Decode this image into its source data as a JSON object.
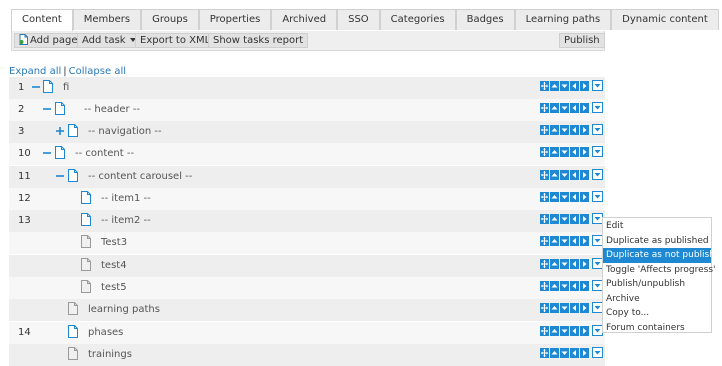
{
  "tabs": [
    {
      "label": "Content",
      "active": true
    },
    {
      "label": "Members"
    },
    {
      "label": "Groups"
    },
    {
      "label": "Properties"
    },
    {
      "label": "Archived"
    },
    {
      "label": "SSO"
    },
    {
      "label": "Categories"
    },
    {
      "label": "Badges"
    },
    {
      "label": "Learning paths"
    },
    {
      "label": "Dynamic content"
    }
  ],
  "toolbar": {
    "add_page": "Add page",
    "add_task": "Add task",
    "export_xml": "Export to XML",
    "show_tasks_report": "Show tasks report",
    "publish": "Publish"
  },
  "tree_controls": {
    "expand_all": "Expand all",
    "separator": "|",
    "collapse_all": "Collapse all"
  },
  "rows": [
    {
      "num": "1",
      "label": "fi",
      "toggle": "minus",
      "icon": "page-blue"
    },
    {
      "num": "2",
      "label": "-- header --",
      "toggle": "minus",
      "icon": "page-blue"
    },
    {
      "num": "3",
      "label": "-- navigation --",
      "toggle": "plus",
      "icon": "page-blue"
    },
    {
      "num": "10",
      "label": "-- content --",
      "toggle": "minus",
      "icon": "page-blue"
    },
    {
      "num": "11",
      "label": "-- content carousel --",
      "toggle": "minus",
      "icon": "page-blue"
    },
    {
      "num": "12",
      "label": "-- item1 --",
      "toggle": "",
      "icon": "page-blue"
    },
    {
      "num": "13",
      "label": "-- item2 --",
      "toggle": "",
      "icon": "page-blue"
    },
    {
      "num": "",
      "label": "Test3",
      "toggle": "",
      "icon": "page-gray"
    },
    {
      "num": "",
      "label": "test4",
      "toggle": "",
      "icon": "page-gray"
    },
    {
      "num": "",
      "label": "test5",
      "toggle": "",
      "icon": "page-gray"
    },
    {
      "num": "",
      "label": "learning paths",
      "toggle": "",
      "icon": "page-gray"
    },
    {
      "num": "14",
      "label": "phases",
      "toggle": "",
      "icon": "page-blue"
    },
    {
      "num": "",
      "label": "trainings",
      "toggle": "",
      "icon": "page-gray"
    }
  ],
  "context_menu": {
    "items": [
      {
        "label": "Edit"
      },
      {
        "label": "Duplicate as published"
      },
      {
        "label": "Duplicate as not published",
        "highlighted": true
      },
      {
        "label": "Toggle 'Affects progress'"
      },
      {
        "label": "Publish/unpublish"
      },
      {
        "label": "Archive"
      },
      {
        "label": "Copy to..."
      },
      {
        "label": "Forum containers"
      }
    ]
  },
  "colors": {
    "accent": "#1e88d2",
    "link": "#2a7ab8",
    "page_icon_gray": "#9a9a9a"
  },
  "icons": {
    "row_controls": [
      "move-icon",
      "arrow-up-icon",
      "arrow-down-icon",
      "arrow-left-icon",
      "arrow-right-icon",
      "menu-dropdown-icon"
    ]
  }
}
